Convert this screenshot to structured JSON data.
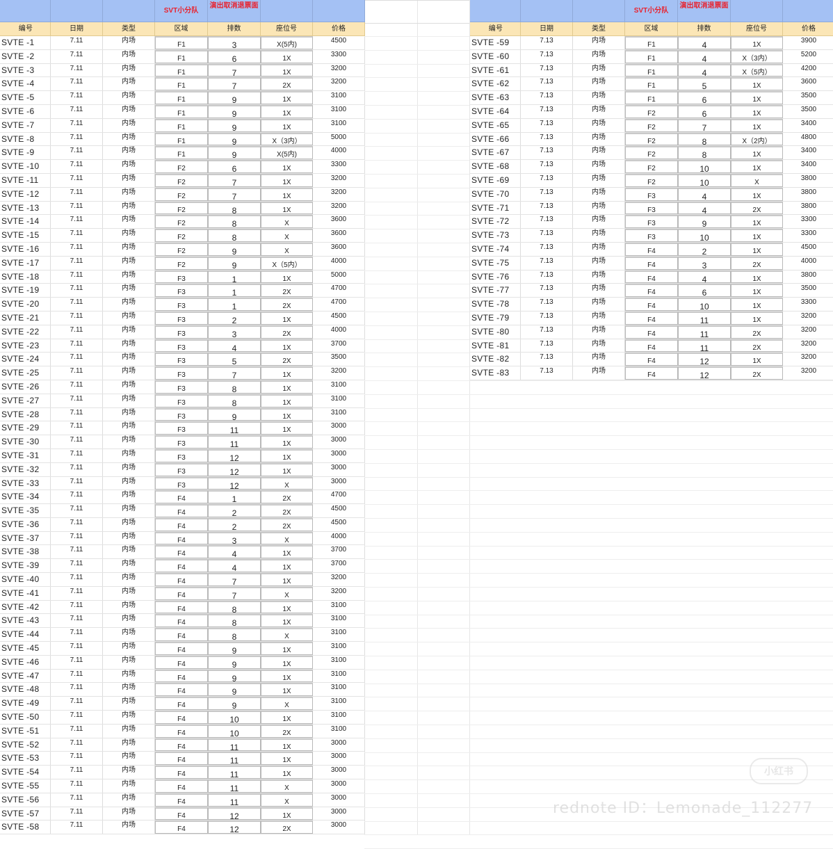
{
  "header_top": [
    "",
    "",
    "",
    "SVT小分队",
    "演出取消退票面",
    "",
    ""
  ],
  "columns": [
    "编号",
    "日期",
    "类型",
    "区域",
    "排数",
    "座位号",
    "价格"
  ],
  "left_rows": [
    [
      "SVTE -1",
      "7.11",
      "内场",
      "F1",
      "3",
      "X(5内)",
      "4500"
    ],
    [
      "SVTE -2",
      "7.11",
      "内场",
      "F1",
      "6",
      "1X",
      "3300"
    ],
    [
      "SVTE -3",
      "7.11",
      "内场",
      "F1",
      "7",
      "1X",
      "3200"
    ],
    [
      "SVTE -4",
      "7.11",
      "内场",
      "F1",
      "7",
      "2X",
      "3200"
    ],
    [
      "SVTE -5",
      "7.11",
      "内场",
      "F1",
      "9",
      "1X",
      "3100"
    ],
    [
      "SVTE -6",
      "7.11",
      "内场",
      "F1",
      "9",
      "1X",
      "3100"
    ],
    [
      "SVTE -7",
      "7.11",
      "内场",
      "F1",
      "9",
      "1X",
      "3100"
    ],
    [
      "SVTE -8",
      "7.11",
      "内场",
      "F1",
      "9",
      "X（3内）",
      "5000"
    ],
    [
      "SVTE -9",
      "7.11",
      "内场",
      "F1",
      "9",
      "X(5内)",
      "4000"
    ],
    [
      "SVTE -10",
      "7.11",
      "内场",
      "F2",
      "6",
      "1X",
      "3300"
    ],
    [
      "SVTE -11",
      "7.11",
      "内场",
      "F2",
      "7",
      "1X",
      "3200"
    ],
    [
      "SVTE -12",
      "7.11",
      "内场",
      "F2",
      "7",
      "1X",
      "3200"
    ],
    [
      "SVTE -13",
      "7.11",
      "内场",
      "F2",
      "8",
      "1X",
      "3200"
    ],
    [
      "SVTE -14",
      "7.11",
      "内场",
      "F2",
      "8",
      "X",
      "3600"
    ],
    [
      "SVTE -15",
      "7.11",
      "内场",
      "F2",
      "8",
      "X",
      "3600"
    ],
    [
      "SVTE -16",
      "7.11",
      "内场",
      "F2",
      "9",
      "X",
      "3600"
    ],
    [
      "SVTE -17",
      "7.11",
      "内场",
      "F2",
      "9",
      "X（5内）",
      "4000"
    ],
    [
      "SVTE -18",
      "7.11",
      "内场",
      "F3",
      "1",
      "1X",
      "5000"
    ],
    [
      "SVTE -19",
      "7.11",
      "内场",
      "F3",
      "1",
      "2X",
      "4700"
    ],
    [
      "SVTE -20",
      "7.11",
      "内场",
      "F3",
      "1",
      "2X",
      "4700"
    ],
    [
      "SVTE -21",
      "7.11",
      "内场",
      "F3",
      "2",
      "1X",
      "4500"
    ],
    [
      "SVTE -22",
      "7.11",
      "内场",
      "F3",
      "3",
      "2X",
      "4000"
    ],
    [
      "SVTE -23",
      "7.11",
      "内场",
      "F3",
      "4",
      "1X",
      "3700"
    ],
    [
      "SVTE -24",
      "7.11",
      "内场",
      "F3",
      "5",
      "2X",
      "3500"
    ],
    [
      "SVTE -25",
      "7.11",
      "内场",
      "F3",
      "7",
      "1X",
      "3200"
    ],
    [
      "SVTE -26",
      "7.11",
      "内场",
      "F3",
      "8",
      "1X",
      "3100"
    ],
    [
      "SVTE -27",
      "7.11",
      "内场",
      "F3",
      "8",
      "1X",
      "3100"
    ],
    [
      "SVTE -28",
      "7.11",
      "内场",
      "F3",
      "9",
      "1X",
      "3100"
    ],
    [
      "SVTE -29",
      "7.11",
      "内场",
      "F3",
      "11",
      "1X",
      "3000"
    ],
    [
      "SVTE -30",
      "7.11",
      "内场",
      "F3",
      "11",
      "1X",
      "3000"
    ],
    [
      "SVTE -31",
      "7.11",
      "内场",
      "F3",
      "12",
      "1X",
      "3000"
    ],
    [
      "SVTE -32",
      "7.11",
      "内场",
      "F3",
      "12",
      "1X",
      "3000"
    ],
    [
      "SVTE -33",
      "7.11",
      "内场",
      "F3",
      "12",
      "X",
      "3000"
    ],
    [
      "SVTE -34",
      "7.11",
      "内场",
      "F4",
      "1",
      "2X",
      "4700"
    ],
    [
      "SVTE -35",
      "7.11",
      "内场",
      "F4",
      "2",
      "2X",
      "4500"
    ],
    [
      "SVTE -36",
      "7.11",
      "内场",
      "F4",
      "2",
      "2X",
      "4500"
    ],
    [
      "SVTE -37",
      "7.11",
      "内场",
      "F4",
      "3",
      "X",
      "4000"
    ],
    [
      "SVTE -38",
      "7.11",
      "内场",
      "F4",
      "4",
      "1X",
      "3700"
    ],
    [
      "SVTE -39",
      "7.11",
      "内场",
      "F4",
      "4",
      "1X",
      "3700"
    ],
    [
      "SVTE -40",
      "7.11",
      "内场",
      "F4",
      "7",
      "1X",
      "3200"
    ],
    [
      "SVTE -41",
      "7.11",
      "内场",
      "F4",
      "7",
      "X",
      "3200"
    ],
    [
      "SVTE -42",
      "7.11",
      "内场",
      "F4",
      "8",
      "1X",
      "3100"
    ],
    [
      "SVTE -43",
      "7.11",
      "内场",
      "F4",
      "8",
      "1X",
      "3100"
    ],
    [
      "SVTE -44",
      "7.11",
      "内场",
      "F4",
      "8",
      "X",
      "3100"
    ],
    [
      "SVTE -45",
      "7.11",
      "内场",
      "F4",
      "9",
      "1X",
      "3100"
    ],
    [
      "SVTE -46",
      "7.11",
      "内场",
      "F4",
      "9",
      "1X",
      "3100"
    ],
    [
      "SVTE -47",
      "7.11",
      "内场",
      "F4",
      "9",
      "1X",
      "3100"
    ],
    [
      "SVTE -48",
      "7.11",
      "内场",
      "F4",
      "9",
      "1X",
      "3100"
    ],
    [
      "SVTE -49",
      "7.11",
      "内场",
      "F4",
      "9",
      "X",
      "3100"
    ],
    [
      "SVTE -50",
      "7.11",
      "内场",
      "F4",
      "10",
      "1X",
      "3100"
    ],
    [
      "SVTE -51",
      "7.11",
      "内场",
      "F4",
      "10",
      "2X",
      "3100"
    ],
    [
      "SVTE -52",
      "7.11",
      "内场",
      "F4",
      "11",
      "1X",
      "3000"
    ],
    [
      "SVTE -53",
      "7.11",
      "内场",
      "F4",
      "11",
      "1X",
      "3000"
    ],
    [
      "SVTE -54",
      "7.11",
      "内场",
      "F4",
      "11",
      "1X",
      "3000"
    ],
    [
      "SVTE -55",
      "7.11",
      "内场",
      "F4",
      "11",
      "X",
      "3000"
    ],
    [
      "SVTE -56",
      "7.11",
      "内场",
      "F4",
      "11",
      "X",
      "3000"
    ],
    [
      "SVTE -57",
      "7.11",
      "内场",
      "F4",
      "12",
      "1X",
      "3000"
    ],
    [
      "SVTE -58",
      "7.11",
      "内场",
      "F4",
      "12",
      "2X",
      "3000"
    ]
  ],
  "right_rows": [
    [
      "SVTE -59",
      "7.13",
      "内场",
      "F1",
      "4",
      "1X",
      "3900"
    ],
    [
      "SVTE -60",
      "7.13",
      "内场",
      "F1",
      "4",
      "X（3内）",
      "5200"
    ],
    [
      "SVTE -61",
      "7.13",
      "内场",
      "F1",
      "4",
      "X（5内）",
      "4200"
    ],
    [
      "SVTE -62",
      "7.13",
      "内场",
      "F1",
      "5",
      "1X",
      "3600"
    ],
    [
      "SVTE -63",
      "7.13",
      "内场",
      "F1",
      "6",
      "1X",
      "3500"
    ],
    [
      "SVTE -64",
      "7.13",
      "内场",
      "F2",
      "6",
      "1X",
      "3500"
    ],
    [
      "SVTE -65",
      "7.13",
      "内场",
      "F2",
      "7",
      "1X",
      "3400"
    ],
    [
      "SVTE -66",
      "7.13",
      "内场",
      "F2",
      "8",
      "X（2内）",
      "4800"
    ],
    [
      "SVTE -67",
      "7.13",
      "内场",
      "F2",
      "8",
      "1X",
      "3400"
    ],
    [
      "SVTE -68",
      "7.13",
      "内场",
      "F2",
      "10",
      "1X",
      "3400"
    ],
    [
      "SVTE -69",
      "7.13",
      "内场",
      "F2",
      "10",
      "X",
      "3800"
    ],
    [
      "SVTE -70",
      "7.13",
      "内场",
      "F3",
      "4",
      "1X",
      "3800"
    ],
    [
      "SVTE -71",
      "7.13",
      "内场",
      "F3",
      "4",
      "2X",
      "3800"
    ],
    [
      "SVTE -72",
      "7.13",
      "内场",
      "F3",
      "9",
      "1X",
      "3300"
    ],
    [
      "SVTE -73",
      "7.13",
      "内场",
      "F3",
      "10",
      "1X",
      "3300"
    ],
    [
      "SVTE -74",
      "7.13",
      "内场",
      "F4",
      "2",
      "1X",
      "4500"
    ],
    [
      "SVTE -75",
      "7.13",
      "内场",
      "F4",
      "3",
      "2X",
      "4000"
    ],
    [
      "SVTE -76",
      "7.13",
      "内场",
      "F4",
      "4",
      "1X",
      "3800"
    ],
    [
      "SVTE -77",
      "7.13",
      "内场",
      "F4",
      "6",
      "1X",
      "3500"
    ],
    [
      "SVTE -78",
      "7.13",
      "内场",
      "F4",
      "10",
      "1X",
      "3300"
    ],
    [
      "SVTE -79",
      "7.13",
      "内场",
      "F4",
      "11",
      "1X",
      "3200"
    ],
    [
      "SVTE -80",
      "7.13",
      "内场",
      "F4",
      "11",
      "2X",
      "3200"
    ],
    [
      "SVTE -81",
      "7.13",
      "内场",
      "F4",
      "11",
      "2X",
      "3200"
    ],
    [
      "SVTE -82",
      "7.13",
      "内场",
      "F4",
      "12",
      "1X",
      "3200"
    ],
    [
      "SVTE -83",
      "7.13",
      "内场",
      "F4",
      "12",
      "2X",
      "3200"
    ]
  ],
  "watermark": {
    "text": "rednote ID：Lemonade_112277",
    "logo": "小红书"
  },
  "colors": {
    "top_header": "#a4c1f4",
    "column_header": "#fbe6b6",
    "accent_red": "#e8232f"
  }
}
